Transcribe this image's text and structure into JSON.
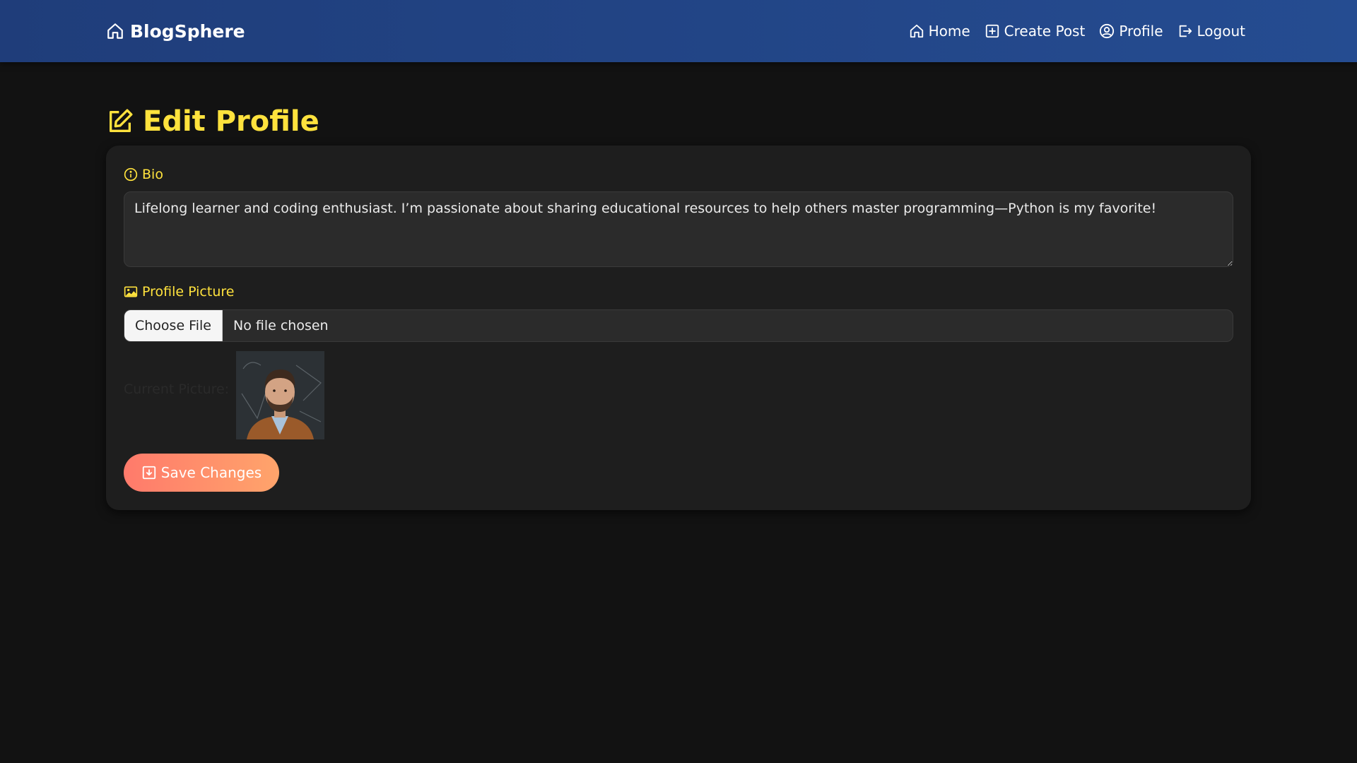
{
  "navbar": {
    "brand": "BlogSphere",
    "links": [
      {
        "label": "Home",
        "icon": "home-icon"
      },
      {
        "label": "Create Post",
        "icon": "plus-square-icon"
      },
      {
        "label": "Profile",
        "icon": "user-circle-icon"
      },
      {
        "label": "Logout",
        "icon": "logout-icon"
      }
    ]
  },
  "page": {
    "title": "Edit Profile"
  },
  "form": {
    "bio_label": "Bio",
    "bio_value": "Lifelong learner and coding enthusiast. I’m passionate about sharing educational resources to help others master programming—Python is my favorite!",
    "picture_label": "Profile Picture",
    "choose_file_label": "Choose File",
    "file_status": "No file chosen",
    "current_picture_label": "Current Picture:",
    "save_label": "Save Changes"
  },
  "colors": {
    "navbar": "#254c91",
    "accent_yellow": "#ffe23d",
    "card_bg": "#1e1e1e",
    "page_bg": "#121212",
    "save_gradient_start": "#ff7a6b",
    "save_gradient_end": "#ffa46b"
  }
}
